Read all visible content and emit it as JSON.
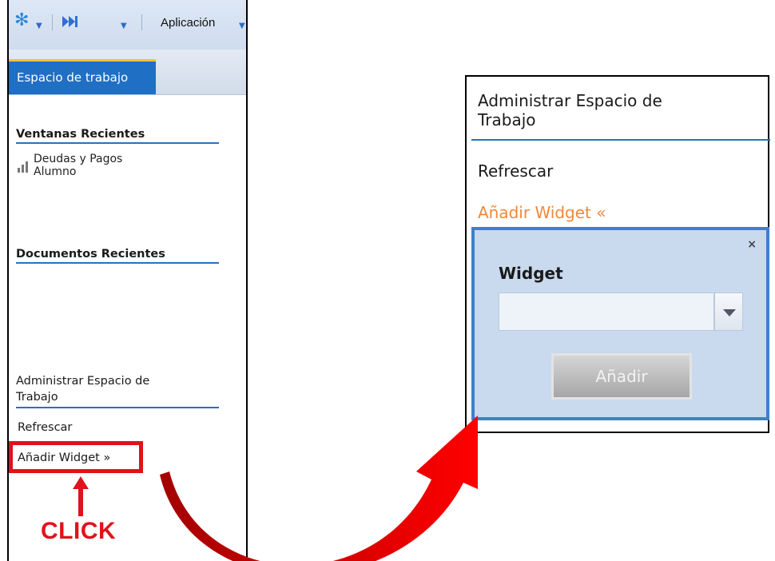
{
  "toolbar": {
    "app_menu_label": "Aplicación",
    "icons": [
      "asterisk-icon",
      "skip-forward-icon",
      "chevron-down-icon"
    ]
  },
  "left_panel": {
    "tab_label": "Espacio de trabajo",
    "recent_windows_title": "Ventanas Recientes",
    "recent_windows_items": [
      {
        "line1": "Deudas y Pagos",
        "line2": "Alumno",
        "icon": "bar-chart-icon"
      }
    ],
    "recent_documents_title": "Documentos Recientes",
    "manage_title_line1": "Administrar Espacio de",
    "manage_title_line2": "Trabajo",
    "refresh_label": "Refrescar",
    "add_widget_label": "Añadir Widget »",
    "click_annotation": "CLICK"
  },
  "right_panel": {
    "title_line1": "Administrar Espacio de",
    "title_line2": "Trabajo",
    "refresh_label": "Refrescar",
    "add_widget_label": "Añadir Widget «",
    "close_symbol": "×",
    "widget_label": "Widget",
    "widget_select_value": "",
    "add_button_label": "Añadir"
  },
  "colors": {
    "accent_blue": "#1f6fc4",
    "annotation_red": "#e0121b",
    "active_link_orange": "#f0883a",
    "tab_top_border": "#f1c23a"
  }
}
